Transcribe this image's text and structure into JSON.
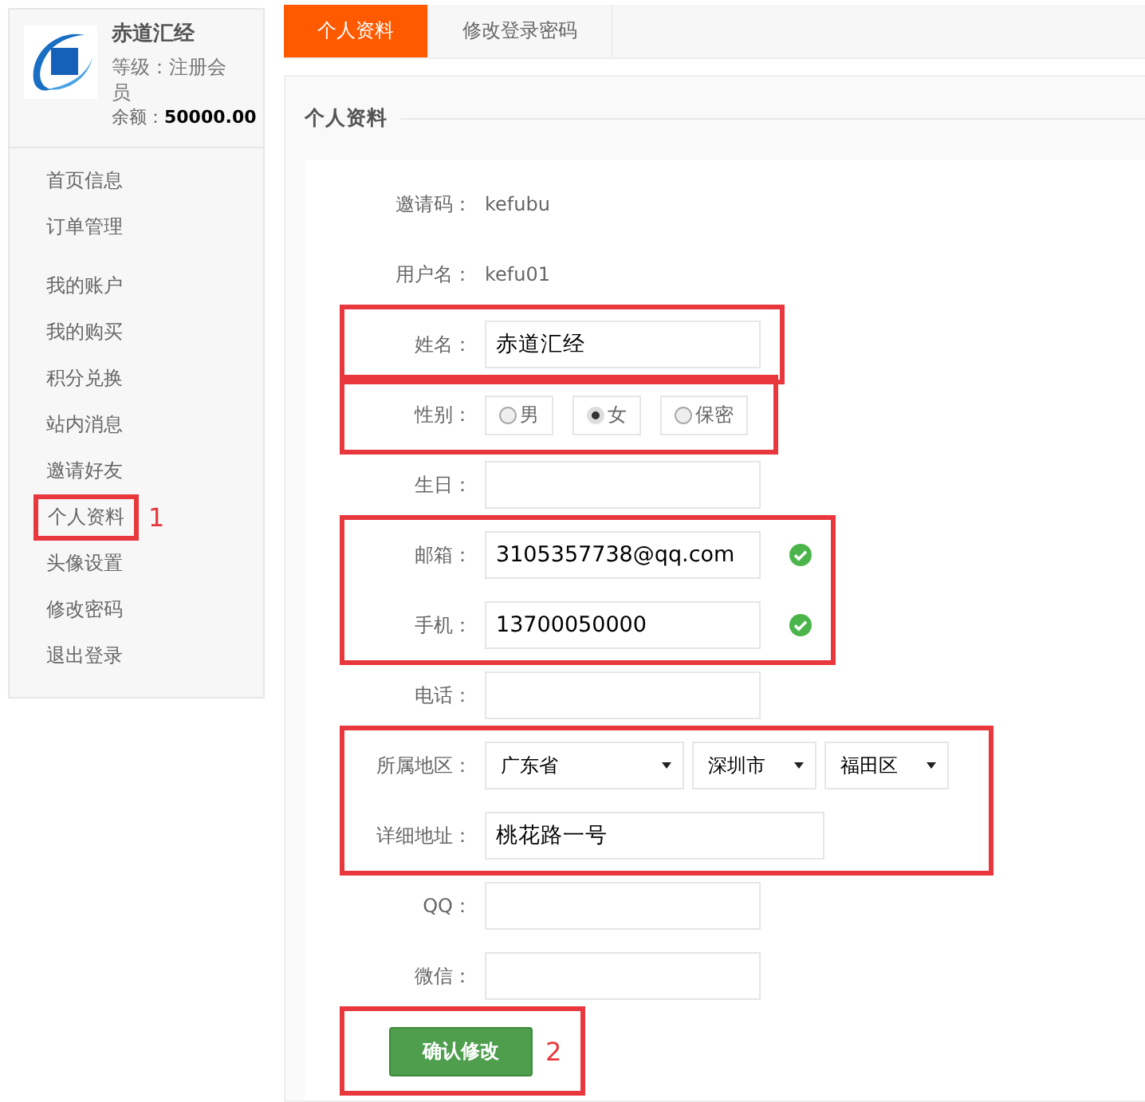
{
  "sidebar": {
    "profile": {
      "name": "赤道汇经",
      "level": "等级：注册会员",
      "balance_label": "余额：",
      "balance": "50000.00"
    },
    "nav_groups": [
      {
        "items": [
          {
            "label": "首页信息",
            "highlighted": false
          },
          {
            "label": "订单管理",
            "highlighted": false
          }
        ]
      },
      {
        "items": [
          {
            "label": "我的账户",
            "highlighted": false
          },
          {
            "label": "我的购买",
            "highlighted": false
          },
          {
            "label": "积分兑换",
            "highlighted": false
          },
          {
            "label": "站内消息",
            "highlighted": false
          },
          {
            "label": "邀请好友",
            "highlighted": false
          },
          {
            "label": "个人资料",
            "highlighted": true,
            "badge": "1"
          },
          {
            "label": "头像设置",
            "highlighted": false
          },
          {
            "label": "修改密码",
            "highlighted": false
          },
          {
            "label": "退出登录",
            "highlighted": false
          }
        ]
      }
    ]
  },
  "tabs": [
    {
      "label": "个人资料",
      "selected": true
    },
    {
      "label": "修改登录密码",
      "selected": false
    }
  ],
  "section_title": "个人资料",
  "form_groups": [
    {
      "highlighted": false,
      "rows": [
        {
          "kind": "static",
          "label": "邀请码：",
          "value": "kefubu"
        },
        {
          "kind": "static",
          "label": "用户名：",
          "value": "kefu01"
        }
      ]
    },
    {
      "highlighted": true,
      "rows": [
        {
          "kind": "input",
          "label": "姓名：",
          "value": "赤道汇经",
          "verified": false
        }
      ]
    },
    {
      "highlighted": true,
      "rows": [
        {
          "kind": "radio",
          "label": "性别：",
          "options": [
            {
              "label": "男",
              "selected": false
            },
            {
              "label": "女",
              "selected": true
            },
            {
              "label": "保密",
              "selected": false
            }
          ]
        }
      ]
    },
    {
      "highlighted": false,
      "rows": [
        {
          "kind": "input",
          "label": "生日：",
          "verified": false
        }
      ]
    },
    {
      "highlighted": true,
      "rows": [
        {
          "kind": "input",
          "label": "邮箱：",
          "value": "3105357738@qq.com",
          "verified": true
        },
        {
          "kind": "input",
          "label": "手机：",
          "value": "13700050000",
          "verified": true
        }
      ]
    },
    {
      "highlighted": false,
      "rows": [
        {
          "kind": "input",
          "label": "电话：",
          "verified": false
        }
      ]
    },
    {
      "highlighted": true,
      "rows": [
        {
          "kind": "selects",
          "label": "所属地区：",
          "options": [
            {
              "value": "广东省"
            },
            {
              "value": "深圳市"
            },
            {
              "value": "福田区"
            }
          ]
        },
        {
          "kind": "long-input",
          "label": "详细地址：",
          "value": "桃花路一号"
        }
      ]
    },
    {
      "highlighted": false,
      "rows": [
        {
          "kind": "input",
          "label": "QQ：",
          "verified": false
        },
        {
          "kind": "input",
          "label": "微信：",
          "verified": false
        }
      ]
    },
    {
      "highlighted": true,
      "rows": [
        {
          "kind": "button",
          "label": "确认修改",
          "badge": "2"
        }
      ]
    }
  ]
}
